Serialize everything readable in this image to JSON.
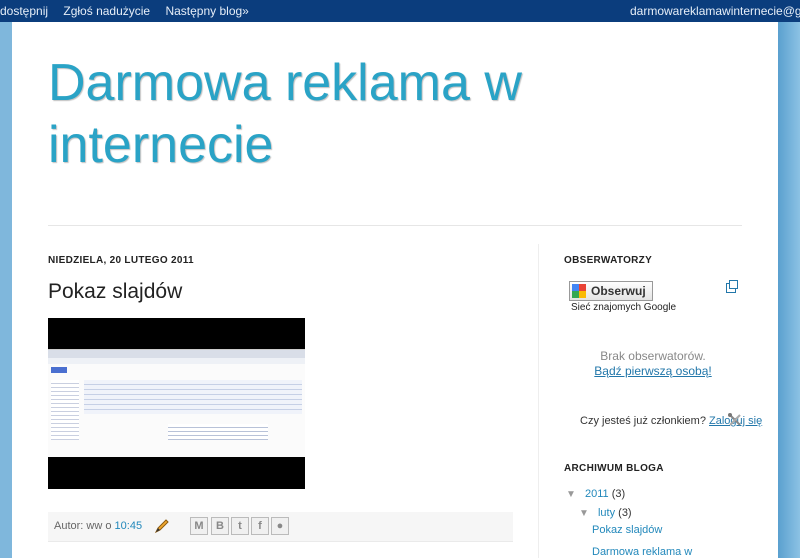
{
  "navbar": {
    "item1": "dostępnij",
    "item2": "Zgłoś nadużycie",
    "item3": "Następny blog»",
    "user": "darmowareklamawinternecie@gm"
  },
  "blog": {
    "title": "Darmowa reklama w internecie"
  },
  "post": {
    "date_header": "NIEDZIELA, 20 LUTEGO 2011",
    "title": "Pokaz slajdów",
    "author_label": "Autor: ww o",
    "time": "10:45"
  },
  "share_icons": [
    "email-icon",
    "blogger-icon",
    "twitter-icon",
    "facebook-icon",
    "buzz-icon"
  ],
  "sidebar": {
    "followers": {
      "heading": "OBSERWATORZY",
      "button_label": "Obserwuj",
      "network": "Sieć znajomych Google",
      "empty": "Brak obserwatorów.",
      "first_link": "Bądź pierwszą osobą!",
      "member_question": "Czy jesteś już członkiem?",
      "login_link": "Zaloguj się"
    },
    "archive": {
      "heading": "ARCHIWUM BLOGA",
      "year": "2011",
      "year_count": "(3)",
      "month": "luty",
      "month_count": "(3)",
      "posts": [
        "Pokaz slajdów",
        "Darmowa reklama w"
      ]
    }
  },
  "colors": {
    "navbar": "#0b3d7d",
    "title": "#2aa3c6",
    "link": "#2288bb",
    "background": "#7fb7dc"
  }
}
